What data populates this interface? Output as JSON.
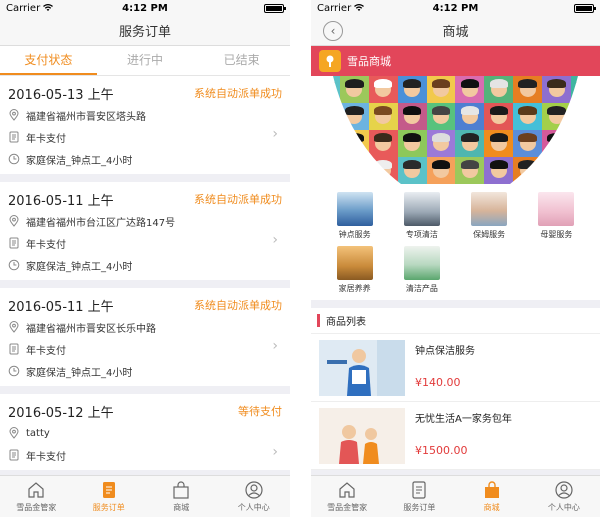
{
  "status_bar": {
    "carrier": "Carrier",
    "time": "4:12 PM"
  },
  "left": {
    "nav_title": "服务订单",
    "tabs": [
      "支付状态",
      "进行中",
      "已结束"
    ],
    "orders": [
      {
        "date": "2016-05-13 上午",
        "status": "系统自动派单成功",
        "address": "福建省福州市晋安区塔头路",
        "payment": "年卡支付",
        "service": "家庭保洁_钟点工_4小时"
      },
      {
        "date": "2016-05-11 上午",
        "status": "系统自动派单成功",
        "address": "福建省福州市台江区广达路147号",
        "payment": "年卡支付",
        "service": "家庭保洁_钟点工_4小时"
      },
      {
        "date": "2016-05-11 上午",
        "status": "系统自动派单成功",
        "address": "福建省福州市晋安区长乐中路",
        "payment": "年卡支付",
        "service": "家庭保洁_钟点工_4小时"
      },
      {
        "date": "2016-05-12 上午",
        "status": "等待支付",
        "address": "tatty",
        "payment": "年卡支付",
        "service": ""
      }
    ]
  },
  "right": {
    "nav_title": "商城",
    "shop_name": "雪品商城",
    "categories": [
      "钟点服务",
      "专项清洁",
      "保姆服务",
      "母婴服务",
      "家居养养",
      "清洁产品"
    ],
    "section_title": "商品列表",
    "products": [
      {
        "name": "钟点保洁服务",
        "price": "¥140.00"
      },
      {
        "name": "无忧生活A一家务包年",
        "price": "¥1500.00"
      }
    ]
  },
  "tabbar": [
    "雪品金管家",
    "服务订单",
    "商城",
    "个人中心"
  ],
  "colors": {
    "accent_orange": "#f08c1e",
    "brand_red": "#e2465a",
    "price_red": "#e23b3b"
  }
}
